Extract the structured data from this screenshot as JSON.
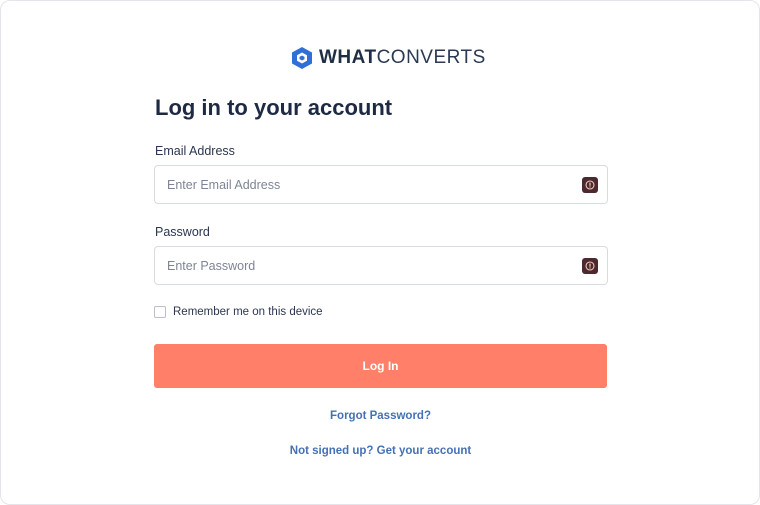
{
  "brand": {
    "name_bold": "WHAT",
    "name_light": "CONVERTS",
    "logo_icon": "hexagon-logo-icon",
    "accent_color": "#2f6fd6"
  },
  "page": {
    "title": "Log in to your account"
  },
  "email": {
    "label": "Email Address",
    "placeholder": "Enter Email Address",
    "value": "",
    "icon": "password-manager-icon"
  },
  "password": {
    "label": "Password",
    "placeholder": "Enter Password",
    "value": "",
    "icon": "password-manager-icon"
  },
  "remember": {
    "label": "Remember me on this device",
    "checked": false
  },
  "login_button": {
    "label": "Log In",
    "color": "#ff7f68"
  },
  "links": {
    "forgot": "Forgot Password?",
    "signup": "Not signed up? Get your account",
    "color": "#4670b5"
  }
}
